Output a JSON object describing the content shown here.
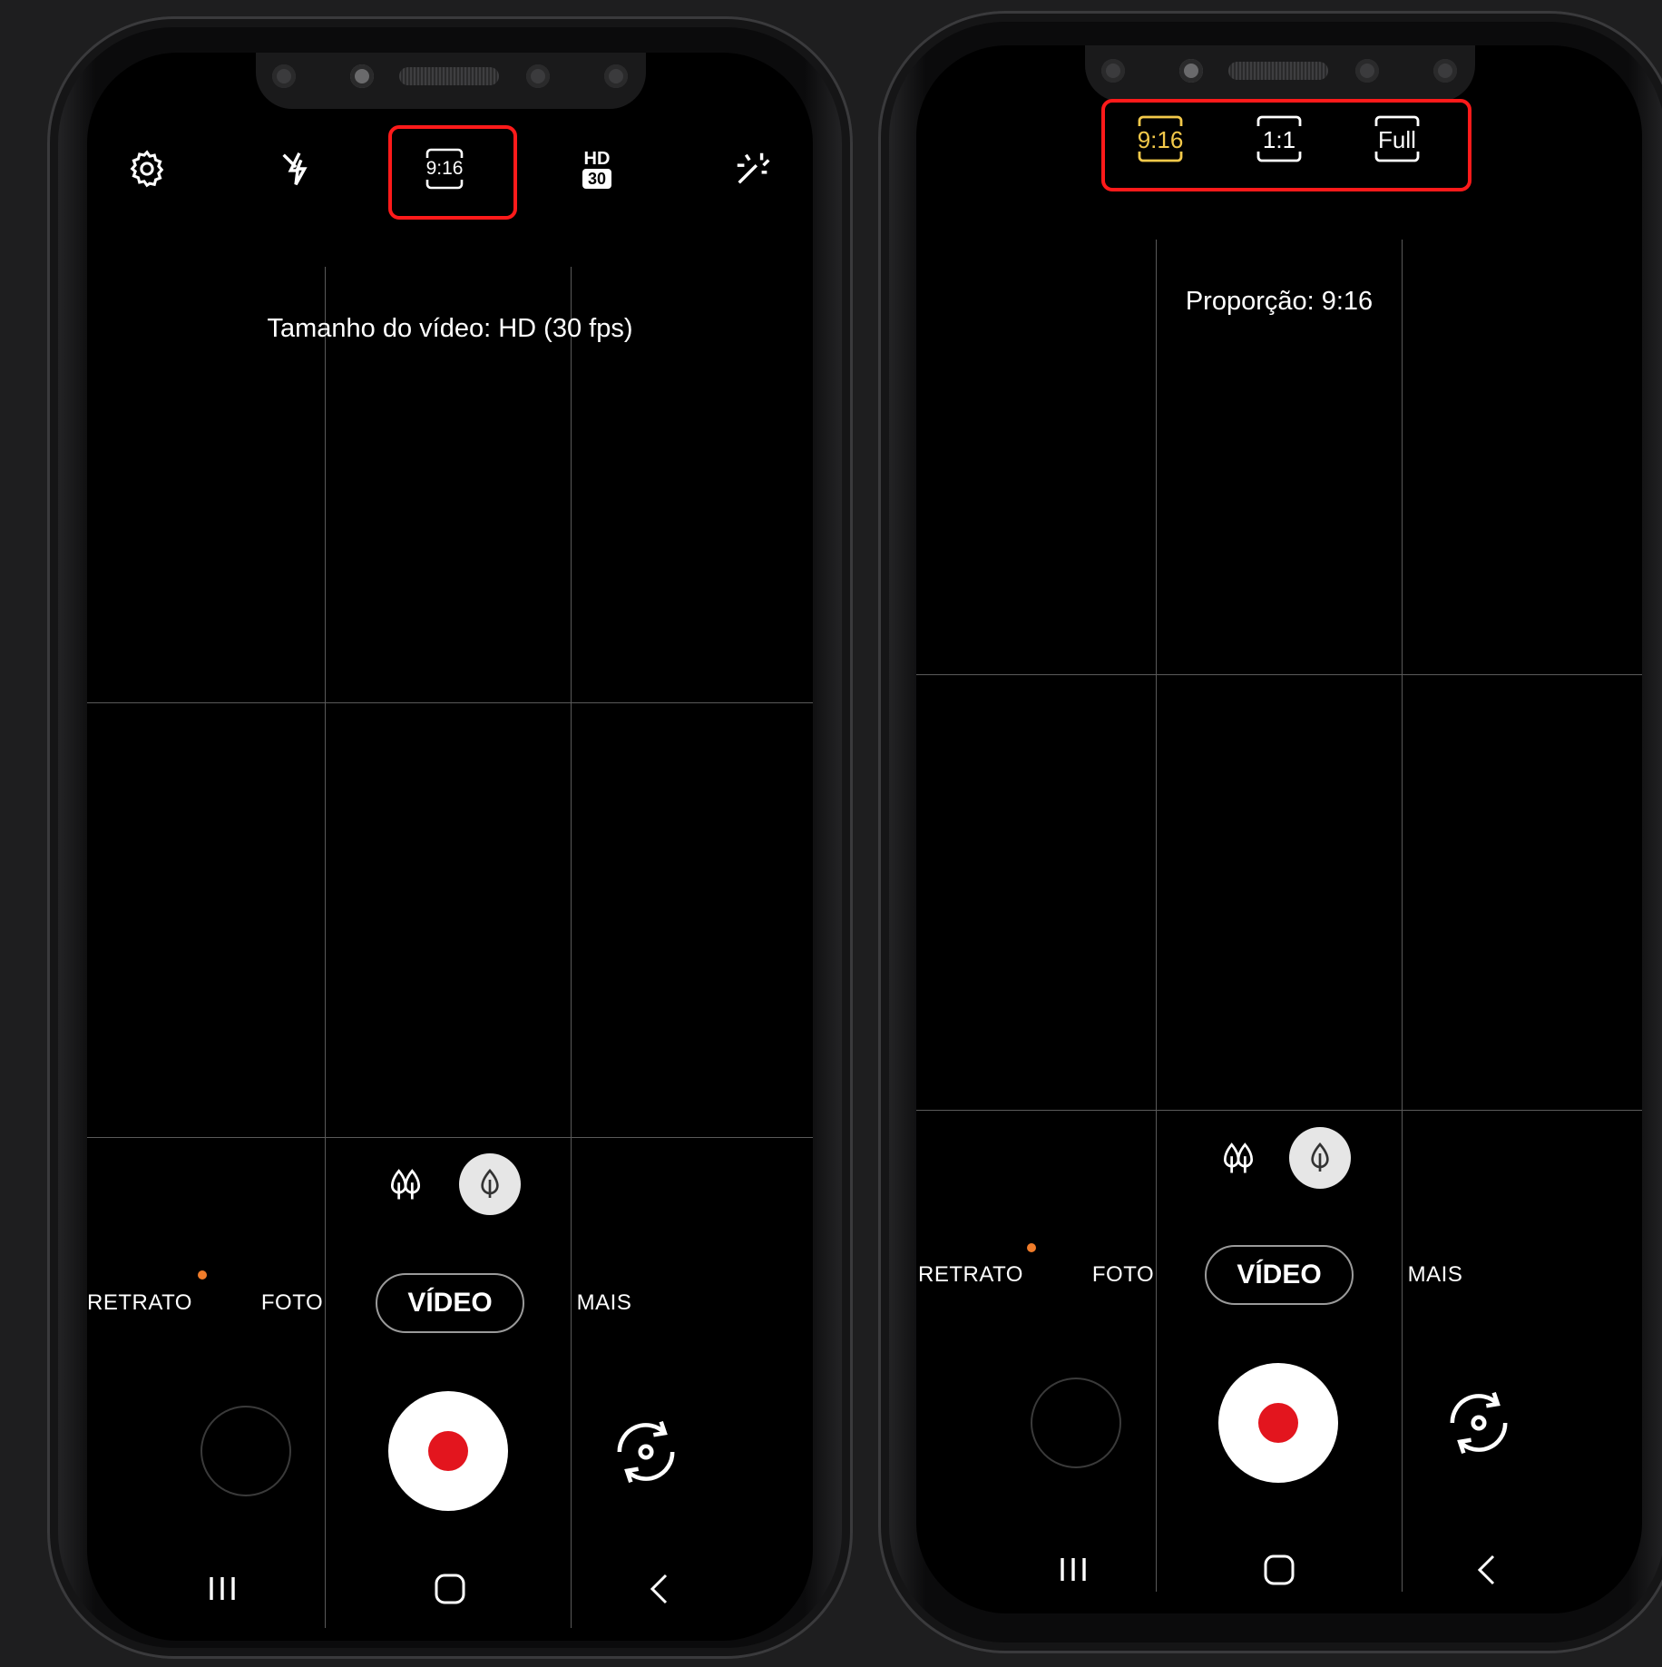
{
  "left_phone": {
    "top_bar": {
      "settings_icon": "gear-icon",
      "flash_icon": "flash-off-icon",
      "ratio_label": "9:16",
      "quality_top": "HD",
      "quality_fps": "30",
      "effects_icon": "sparkle-icon"
    },
    "toast": "Tamanho do vídeo: HD (30 fps)",
    "zoom": {
      "wide_icon": "trees-icon",
      "normal_icon": "tree-icon"
    },
    "modes": [
      "RETRATO",
      "FOTO",
      "VÍDEO",
      "MAIS"
    ],
    "nav": {
      "recent": "III",
      "home": "home-icon",
      "back": "back-icon"
    }
  },
  "right_phone": {
    "ratio_options": [
      "9:16",
      "1:1",
      "Full"
    ],
    "selected_ratio": "9:16",
    "toast": "Proporção: 9:16",
    "zoom": {
      "wide_icon": "trees-icon",
      "normal_icon": "tree-icon"
    },
    "modes": [
      "RETRATO",
      "FOTO",
      "VÍDEO",
      "MAIS"
    ],
    "nav": {
      "recent": "III",
      "home": "home-icon",
      "back": "back-icon"
    }
  },
  "colors": {
    "highlight": "#ff1a1a",
    "selected_ratio": "#f3c94a",
    "record": "#e3151e",
    "mode_dot": "#f07c2a"
  }
}
